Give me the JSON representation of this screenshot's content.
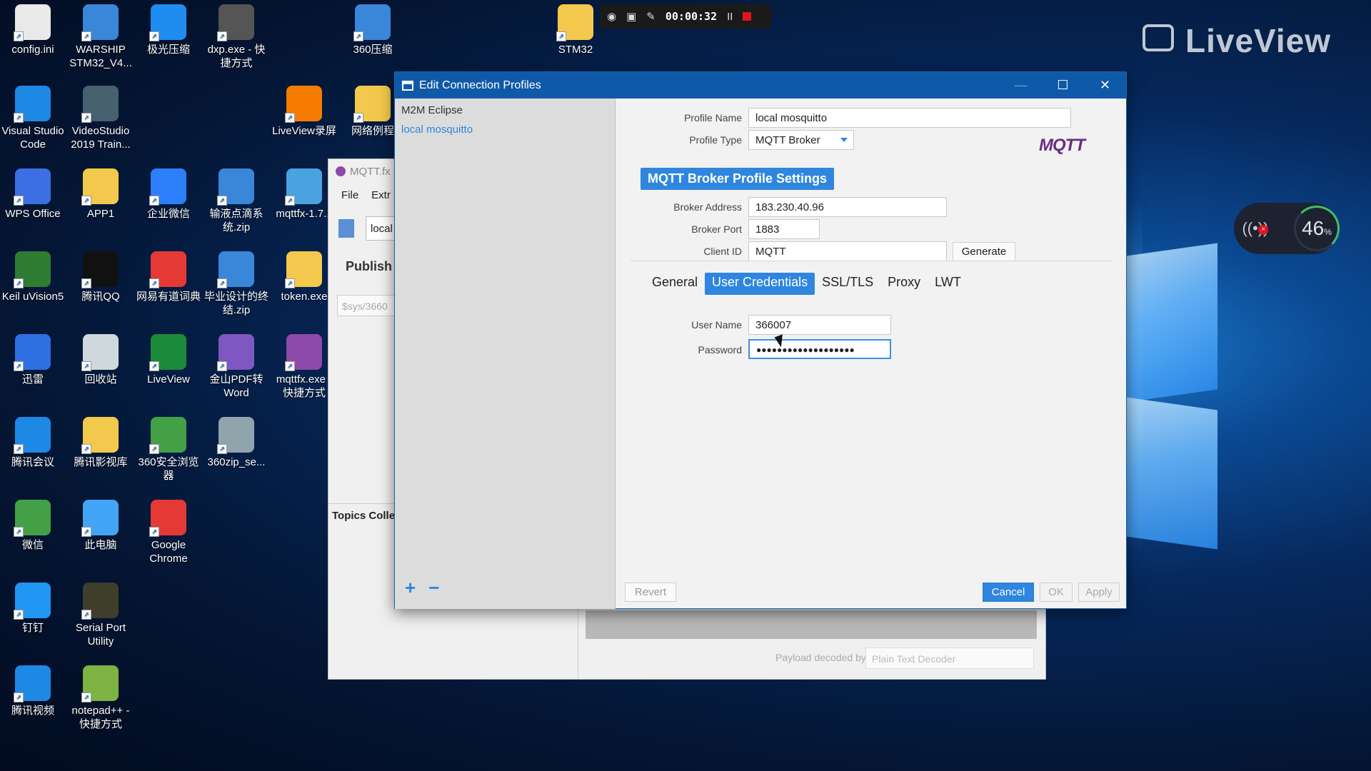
{
  "desktop": {
    "icons": [
      {
        "label": "config.ini",
        "icon": "config-file-icon",
        "color": "#e9e9e9"
      },
      {
        "label": "WARSHIP STM32_V4...",
        "icon": "winrar-archive-icon",
        "color": "#3a86d8"
      },
      {
        "label": "极光压缩",
        "icon": "archive-app-icon",
        "color": "#1f8df0"
      },
      {
        "label": "dxp.exe - 快捷方式",
        "icon": "dxp-app-icon",
        "color": "#555555"
      },
      {
        "label": "360压缩",
        "icon": "archive-icon",
        "color": "#3a86d8"
      },
      {
        "label": "STM32",
        "icon": "folder-icon",
        "color": "#f2c94c"
      },
      {
        "label": "Visual Studio Code",
        "icon": "vscode-icon",
        "color": "#1e88e5"
      },
      {
        "label": "VideoStudio 2019 Train...",
        "icon": "videostudio-icon",
        "color": "#46606e"
      },
      {
        "label": "LiveView录屏",
        "icon": "liveview-recorder-icon",
        "color": "#f57c00"
      },
      {
        "label": "网络例程",
        "icon": "folder-icon",
        "color": "#f2c94c"
      },
      {
        "label": "WPS Office",
        "icon": "wps-office-icon",
        "color": "#3b6fe3"
      },
      {
        "label": "APP1",
        "icon": "folder-icon",
        "color": "#f2c94c"
      },
      {
        "label": "企业微信",
        "icon": "wecom-icon",
        "color": "#2d7ff9"
      },
      {
        "label": "输液点滴系统.zip",
        "icon": "archive-icon",
        "color": "#3a86d8"
      },
      {
        "label": "mqttfx-1.7...",
        "icon": "installer-icon",
        "color": "#4aa3df"
      },
      {
        "label": "Keil uVision5",
        "icon": "keil-icon",
        "color": "#2e7d32"
      },
      {
        "label": "腾讯QQ",
        "icon": "qq-icon",
        "color": "#111111"
      },
      {
        "label": "网易有道词典",
        "icon": "youdao-icon",
        "color": "#e53935"
      },
      {
        "label": "毕业设计的终结.zip",
        "icon": "archive-icon",
        "color": "#3a86d8"
      },
      {
        "label": "token.exe",
        "icon": "exe-icon",
        "color": "#f2c94c"
      },
      {
        "label": "迅雷",
        "icon": "thunder-icon",
        "color": "#2f6fe4"
      },
      {
        "label": "回收站",
        "icon": "recycle-bin-icon",
        "color": "#cfd8dc"
      },
      {
        "label": "LiveView",
        "icon": "liveview-icon",
        "color": "#1b8a3a"
      },
      {
        "label": "金山PDF转Word",
        "icon": "pdf-convert-icon",
        "color": "#7e57c2"
      },
      {
        "label": "mqttfx.exe - 快捷方式",
        "icon": "mqttfx-icon",
        "color": "#8e4aa8"
      },
      {
        "label": "腾讯会议",
        "icon": "tencent-meeting-icon",
        "color": "#1e88e5"
      },
      {
        "label": "腾讯影视库",
        "icon": "folder-icon",
        "color": "#f2c94c"
      },
      {
        "label": "360安全浏览器",
        "icon": "360-browser-icon",
        "color": "#43a047"
      },
      {
        "label": "360zip_se...",
        "icon": "installer-icon",
        "color": "#90a4ae"
      },
      {
        "label": "微信",
        "icon": "wechat-icon",
        "color": "#43a047"
      },
      {
        "label": "此电脑",
        "icon": "this-pc-icon",
        "color": "#42a5f5"
      },
      {
        "label": "Google Chrome",
        "icon": "chrome-icon",
        "color": "#e53935"
      },
      {
        "label": "钉钉",
        "icon": "dingtalk-icon",
        "color": "#2196f3"
      },
      {
        "label": "Serial Port Utility",
        "icon": "serial-port-icon",
        "color": "#3e3e2a"
      },
      {
        "label": "腾讯视频",
        "icon": "tencent-video-icon",
        "color": "#1e88e5"
      },
      {
        "label": "notepad++ - 快捷方式",
        "icon": "notepadpp-icon",
        "color": "#7cb342"
      }
    ]
  },
  "recorder": {
    "time": "00:00:32",
    "pause": "II"
  },
  "watermark": {
    "text": "LiveView"
  },
  "network_widget": {
    "percent": "46",
    "unit": "%"
  },
  "background_window": {
    "title": "MQTT.fx",
    "menu": [
      "File",
      "Extr"
    ],
    "profile_value": "local",
    "publish_label": "Publish",
    "topic_placeholder": "$sys/3660",
    "topics_collector": "Topics Collec",
    "payload_label": "Payload decoded by",
    "payload_decoder": "Plain Text Decoder"
  },
  "dialog": {
    "title": "Edit Connection Profiles",
    "profiles": [
      "M2M Eclipse",
      "local mosquitto"
    ],
    "selected_profile": "local mosquitto",
    "add_label": "+",
    "remove_label": "−",
    "profile_name_label": "Profile Name",
    "profile_name": "local mosquitto",
    "profile_type_label": "Profile Type",
    "profile_type": "MQTT Broker",
    "logo_text": "MQTT",
    "section_title": "MQTT Broker Profile Settings",
    "broker_address_label": "Broker Address",
    "broker_address": "183.230.40.96",
    "broker_port_label": "Broker Port",
    "broker_port": "1883",
    "client_id_label": "Client ID",
    "client_id": "MQTT",
    "generate_label": "Generate",
    "tabs": [
      "General",
      "User Credentials",
      "SSL/TLS",
      "Proxy",
      "LWT"
    ],
    "active_tab": "User Credentials",
    "user_name_label": "User Name",
    "user_name": "366007",
    "password_label": "Password",
    "password_masked": "●●●●●●●●●●●●●●●●●●●",
    "revert_label": "Revert",
    "cancel_label": "Cancel",
    "ok_label": "OK",
    "apply_label": "Apply"
  },
  "colors": {
    "accent": "#2e86de",
    "title_bar": "#0f5aa8"
  }
}
